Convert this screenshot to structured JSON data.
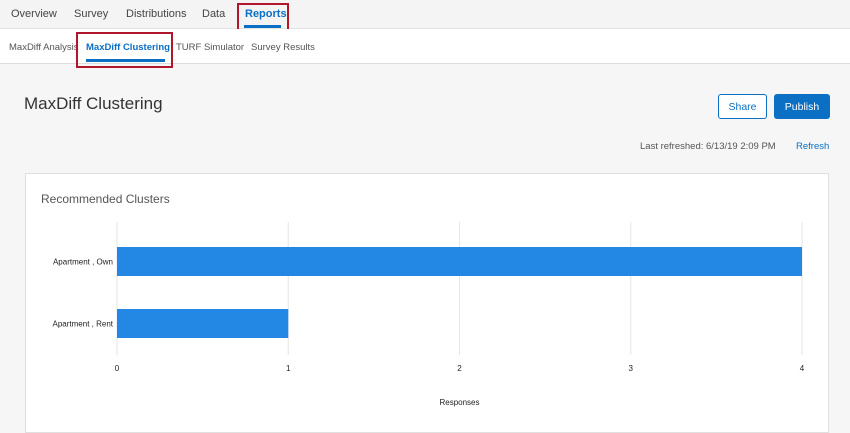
{
  "top_nav": {
    "items": [
      "Overview",
      "Survey",
      "Distributions",
      "Data",
      "Reports"
    ],
    "active": "Reports"
  },
  "sub_nav": {
    "items": [
      "MaxDiff Analysis",
      "MaxDiff Clustering",
      "TURF Simulator",
      "Survey Results"
    ],
    "active": "MaxDiff Clustering"
  },
  "page": {
    "title": "MaxDiff Clustering",
    "share_label": "Share",
    "publish_label": "Publish",
    "last_refreshed": "Last refreshed: 6/13/19 2:09 PM",
    "refresh_label": "Refresh"
  },
  "colors": {
    "accent": "#0b6fc4",
    "bar": "#2288e3",
    "highlight": "#b0172c"
  },
  "chart_data": {
    "type": "bar",
    "orientation": "horizontal",
    "title": "Recommended Clusters",
    "categories": [
      "Apartment , Own",
      "Apartment , Rent"
    ],
    "values": [
      4,
      1
    ],
    "xlabel": "Responses",
    "ylabel": "",
    "xlim": [
      0,
      4
    ],
    "xticks": [
      "0",
      "1",
      "2",
      "3",
      "4"
    ],
    "grid": true
  }
}
